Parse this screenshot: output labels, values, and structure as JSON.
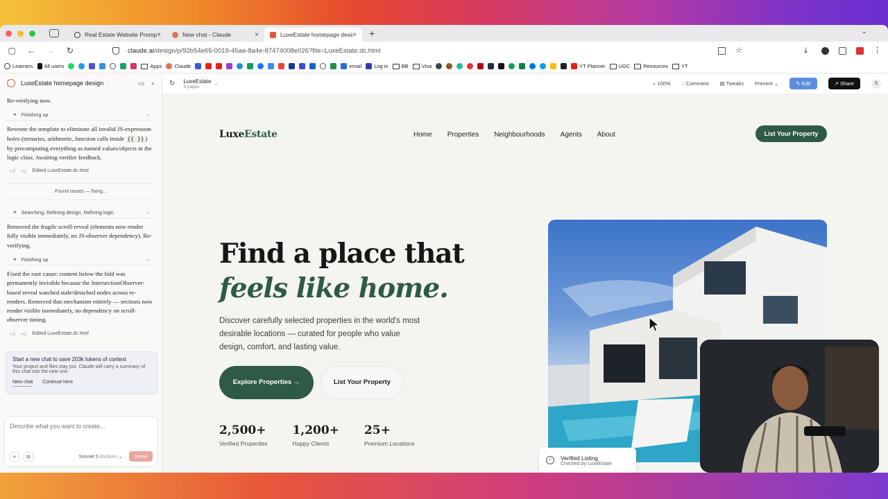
{
  "browser": {
    "tabs": [
      {
        "title": "Real Estate Website Prompt",
        "active": false
      },
      {
        "title": "New chat - Claude",
        "active": false
      },
      {
        "title": "LuxeEstate homepage design",
        "active": true
      }
    ],
    "url_host": "claude.ai",
    "url_path": "/design/p/92b54e65-0019-45aa-8a4e-87474008e026?file=LuxeEstate.dc.html",
    "bookmarks": [
      "Learners",
      "All users",
      "Apps",
      "Claude",
      "email",
      "Log in",
      "BB",
      "Visa",
      "YT Planner",
      "UGC",
      "Resources",
      "YT"
    ]
  },
  "sidebar": {
    "title": "LuxeEstate homepage design",
    "messages": {
      "m1": "Re-verifying now.",
      "step1": "Finishing up",
      "m2a": "Rewrote the template to eliminate all invalid JS-expression holes (ternaries, arithmetic, function calls inside",
      "m2code": "{{ }}",
      "m2b": ") by precomputing everything as named values/objects in the logic class. Awaiting verifier feedback.",
      "edited1": "Edited LuxeEstate.dc.html",
      "found": "Found issues — fixing...",
      "step2": "Searching, Refining design, Refining logic",
      "m3": "Removed the fragile scroll-reveal (elements now render fully visible immediately, no JS-observer dependency). Re-verifying.",
      "step3": "Finishing up",
      "m4": "Fixed the root cause: content below the fold was permanently invisible because the IntersectionObserver-based reveal watched stale/detached nodes across re-renders. Removed that mechanism entirely — sections now render visible immediately, no dependency on scroll-observer timing.",
      "edited2": "Edited LuxeEstate.dc.html"
    },
    "context_box": {
      "title": "Start a new chat to save 203k tokens of context",
      "body": "Your project and files stay put. Claude will carry a summary of this chat into the new one.",
      "new_chat": "New chat",
      "continue": "Continue here"
    },
    "composer": {
      "placeholder": "Describe what you want to create...",
      "model": "Sonnet 5",
      "effort": "Medium",
      "send": "Send"
    }
  },
  "preview_toolbar": {
    "title": "LuxeEstate",
    "pages": "4 pages",
    "zoom": "100%",
    "comment": "Comment",
    "tweaks": "Tweaks",
    "present": "Present",
    "edit": "Edit",
    "share": "Share",
    "avatar": "S"
  },
  "site": {
    "logo_a": "Luxe",
    "logo_b": "Estate",
    "nav": [
      "Home",
      "Properties",
      "Neighbourhoods",
      "Agents",
      "About"
    ],
    "cta": "List Your Property",
    "headline_1": "Find a place that",
    "headline_2": "feels like home.",
    "subtext": "Discover carefully selected properties in the world's most desirable locations — curated for people who value design, comfort, and lasting value.",
    "primary_btn": "Explore Properties →",
    "secondary_btn": "List Your Property",
    "stats": [
      {
        "num": "2,500+",
        "label": "Verified Properties"
      },
      {
        "num": "1,200+",
        "label": "Happy Clients"
      },
      {
        "num": "25+",
        "label": "Premium Locations"
      }
    ],
    "badge_title": "Verified Listing",
    "badge_sub": "Checked by LuxeEstate"
  },
  "colors": {
    "brand_green": "#2f5a45",
    "edit_blue": "#5b8fde",
    "send_disabled": "#e9a69c"
  }
}
